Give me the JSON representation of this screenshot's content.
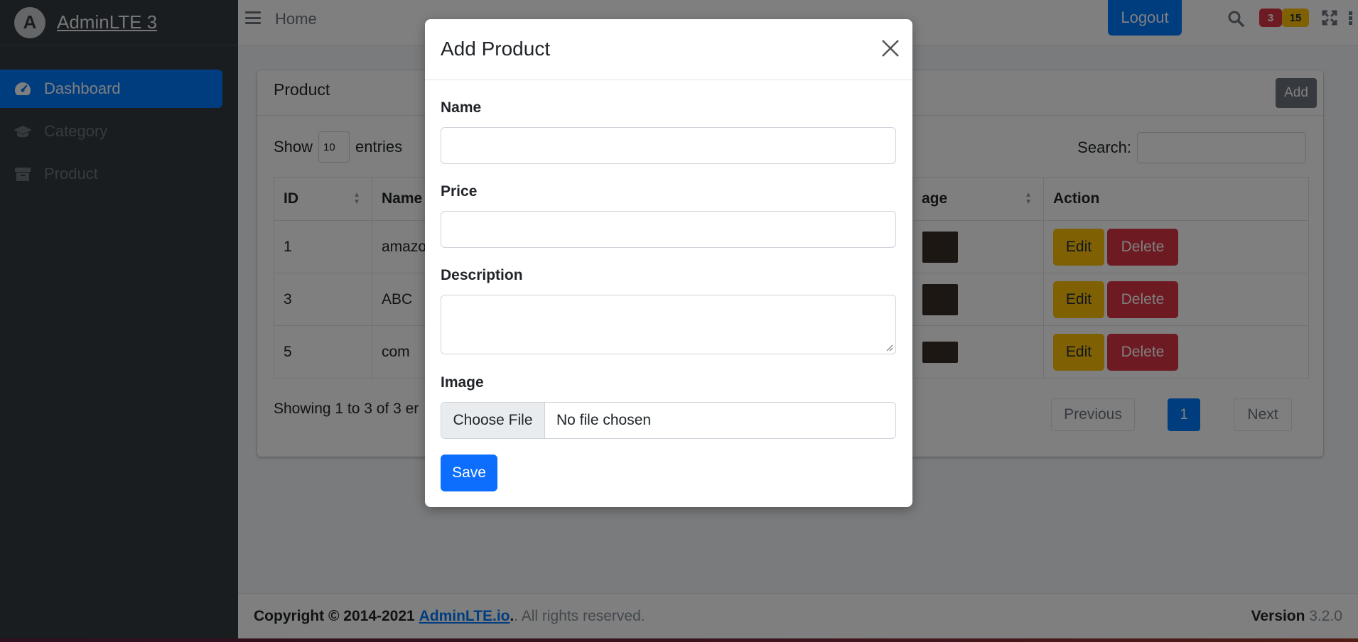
{
  "brand": {
    "name": "AdminLTE 3",
    "logo_letter": "A"
  },
  "sidebar": {
    "items": [
      {
        "label": "Dashboard",
        "icon": "tachometer-icon",
        "active": true
      },
      {
        "label": "Category",
        "icon": "graduation-cap-icon",
        "active": false
      },
      {
        "label": "Product",
        "icon": "archive-icon",
        "active": false
      }
    ]
  },
  "navbar": {
    "home": "Home",
    "logout": "Logout",
    "badge_messages": "3",
    "badge_notifications": "15"
  },
  "card": {
    "title": "Product",
    "add_label": "Add",
    "show_label": "Show",
    "entries_value": "10",
    "entries_label": "entries",
    "search_label": "Search:",
    "columns": [
      "ID",
      "Name",
      "age",
      "Action"
    ],
    "rows": [
      {
        "id": "1",
        "name": "amazo"
      },
      {
        "id": "3",
        "name": "ABC"
      },
      {
        "id": "5",
        "name": "com"
      }
    ],
    "edit_label": "Edit",
    "delete_label": "Delete",
    "showing_text": "Showing 1 to 3 of 3 er",
    "pager": {
      "previous": "Previous",
      "current": "1",
      "next": "Next"
    }
  },
  "footer": {
    "copyright_prefix": "Copyright © 2014-2021",
    "link": "AdminLTE.io",
    "suffix": ". All rights reserved.",
    "version_label": "Version",
    "version": "3.2.0"
  },
  "modal": {
    "title": "Add Product",
    "name_label": "Name",
    "price_label": "Price",
    "description_label": "Description",
    "image_label": "Image",
    "choose_file": "Choose File",
    "file_status": "No file chosen",
    "save_label": "Save"
  },
  "colors": {
    "primary": "#007bff",
    "warning": "#ffc107",
    "danger": "#dc3545",
    "sidebar": "#343a40"
  }
}
